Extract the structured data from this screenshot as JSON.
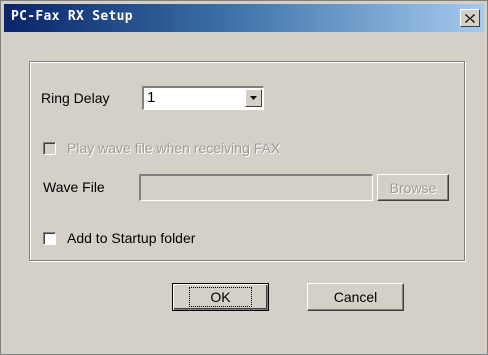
{
  "window": {
    "title": "PC-Fax RX Setup",
    "close_icon": "close-icon"
  },
  "ring_delay": {
    "label": "Ring Delay",
    "value": "1",
    "arrow_icon": "chevron-down-icon"
  },
  "play_wave": {
    "label": "Play wave file when receiving FAX",
    "checked": false,
    "enabled": false
  },
  "wave_file": {
    "label": "Wave File",
    "value": "",
    "browse_label": "Browse"
  },
  "startup": {
    "label": "Add to Startup folder",
    "checked": false
  },
  "buttons": {
    "ok_label": "OK",
    "cancel_label": "Cancel"
  }
}
